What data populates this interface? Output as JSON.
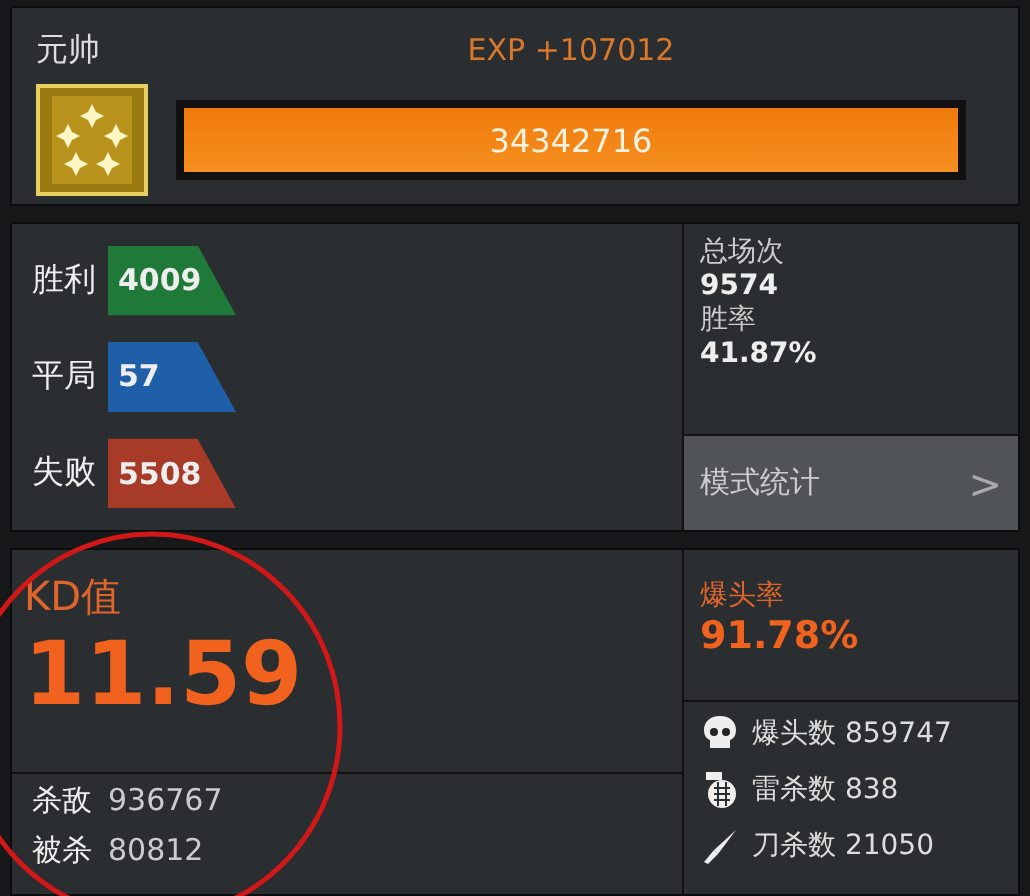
{
  "rank": {
    "title": "元帅"
  },
  "exp": {
    "gain": "EXP +107012",
    "total": "34342716",
    "level": 1
  },
  "results": [
    {
      "label": "胜利",
      "value": "4009",
      "color": "#1f7a3a"
    },
    {
      "label": "平局",
      "value": "57",
      "color": "#1f5fa8"
    },
    {
      "label": "失败",
      "value": "5508",
      "color": "#a83a28"
    }
  ],
  "summary": [
    {
      "label": "总场次",
      "value": "9574"
    },
    {
      "label": "胜率",
      "value": "41.87%"
    }
  ],
  "mode_stats": {
    "label": "模式统计",
    "chevron": ">"
  },
  "kd": {
    "label": "KD值",
    "value": "11.59",
    "annotated": true
  },
  "kills": [
    {
      "label": "杀敌",
      "value": "936767"
    },
    {
      "label": "被杀",
      "value": "80812"
    }
  ],
  "headshot_rate": {
    "label": "爆头率",
    "value": "91.78%"
  },
  "kill_types": [
    {
      "kind": "skull",
      "text": "爆头数 859747"
    },
    {
      "kind": "grenade",
      "text": "雷杀数 838"
    },
    {
      "kind": "knife",
      "text": "刀杀数 21050"
    }
  ]
}
